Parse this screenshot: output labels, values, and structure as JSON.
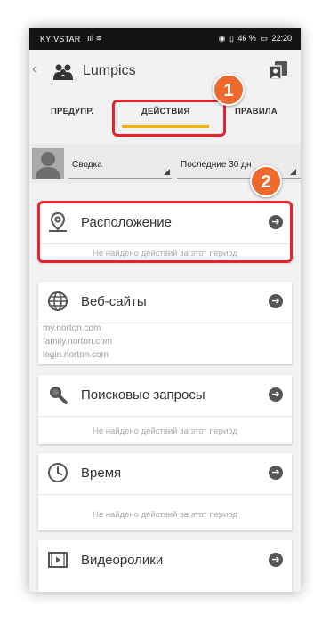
{
  "statusbar": {
    "carrier": "KYIVSTAR",
    "icons_left": "ııl ≋",
    "battery_text": "46 %",
    "time": "22:20"
  },
  "appbar": {
    "back_glyph": "‹",
    "title": "Lumpics"
  },
  "tabs": [
    {
      "label": "ПРЕДУПР."
    },
    {
      "label": "ДЕЙСТВИЯ"
    },
    {
      "label": "ПРАВИЛА"
    }
  ],
  "filters": {
    "summary": "Сводка",
    "period": "Последние 30 дн"
  },
  "annotations": {
    "badge1": "1",
    "badge2": "2"
  },
  "cards": {
    "location": {
      "title": "Расположение",
      "note": "Не найдено действий за этот период"
    },
    "websites": {
      "title": "Веб-сайты",
      "sites": [
        "my.norton.com",
        "family.norton.com",
        "login.norton.com"
      ]
    },
    "search": {
      "title": "Поисковые запросы",
      "note": "Не найдено действий за этот период"
    },
    "time": {
      "title": "Время",
      "note": "Не найдено действий за этот период"
    },
    "video": {
      "title": "Видеоролики"
    }
  },
  "colors": {
    "accent_tab": "#f5b400",
    "annotation_red": "#e8212b",
    "badge_orange": "#ee6a2c"
  }
}
